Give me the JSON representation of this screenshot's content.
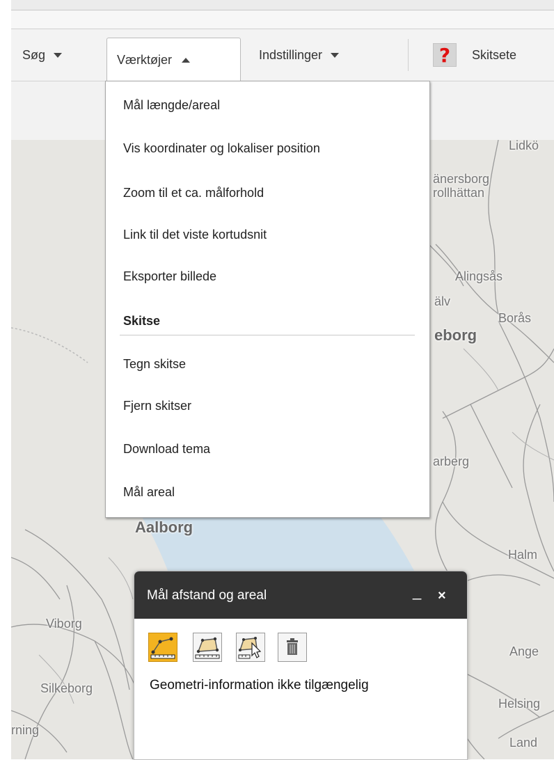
{
  "toolbar": {
    "search_label": "Søg",
    "tools_label": "Værktøjer",
    "settings_label": "Indstillinger",
    "help_symbol": "?",
    "sketch_label": "Skitsete"
  },
  "tools_menu": {
    "items": [
      "Mål længde/areal",
      "Vis koordinater og lokaliser position",
      "Zoom til et ca. målforhold",
      "Link til det viste kortudsnit",
      "Eksporter billede"
    ],
    "section_heading": "Skitse",
    "section_items": [
      "Tegn skitse",
      "Fjern skitser",
      "Download tema",
      "Mål areal"
    ]
  },
  "map": {
    "labels": {
      "lidkoping": "Lidkö",
      "vanersborg": "änersborg",
      "trollhattan": "rollhättan",
      "alingsas": "Alingsås",
      "lv": "älv",
      "boras": "Borås",
      "goteborg": "eborg",
      "varberg": "arberg",
      "aalborg": "Aalborg",
      "halmstad": "Halm",
      "viborg": "Viborg",
      "angelholm": "Ange",
      "silkeborg": "Silkeborg",
      "helsingborg": "Helsing",
      "herning": "rning",
      "landskrona": "Land"
    }
  },
  "measure_panel": {
    "title": "Mål afstand og areal",
    "minimize": "_",
    "close": "×",
    "tools": [
      "measure-distance-icon",
      "measure-area-icon",
      "select-area-icon",
      "trash-icon"
    ],
    "message": "Geometri-information ikke tilgængelig"
  },
  "colors": {
    "panel_header": "#333333",
    "active_tool": "#f3b320",
    "help_icon": "#e01010",
    "map_water": "#cfe0ec"
  }
}
